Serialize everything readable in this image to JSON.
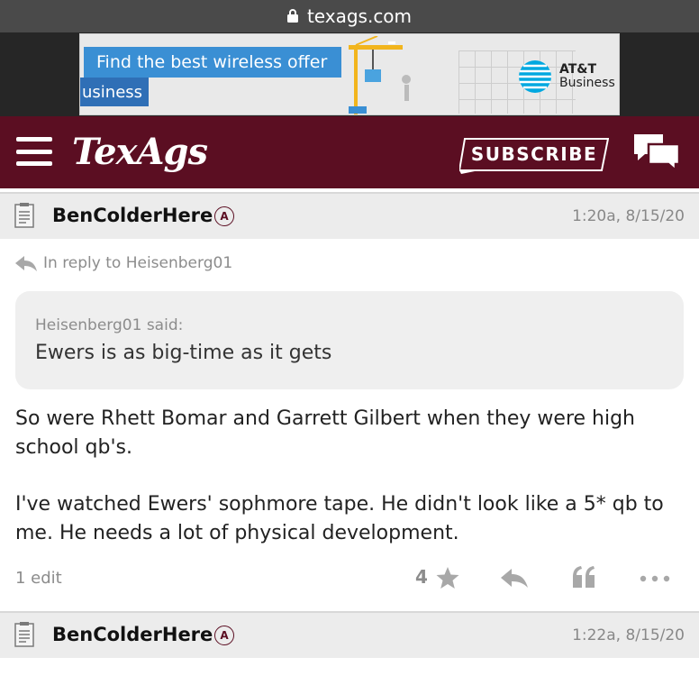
{
  "browser": {
    "url": "texags.com",
    "lock_icon": "lock-icon"
  },
  "ad": {
    "offer_text": "Find the best wireless offer",
    "business_text": "usiness",
    "brand_line1": "AT&T",
    "brand_line2": "Business",
    "brand_color": "#00a8e0"
  },
  "site": {
    "logo": "TexAgs",
    "subscribe_label": "SUBSCRIBE",
    "menu_icon": "hamburger-menu-icon",
    "chat_icon": "chat-bubbles-icon",
    "header_color": "#5b0e22"
  },
  "posts": [
    {
      "author": "BenColderHere",
      "badge": "A",
      "time": "1:20a, 8/15/20",
      "reply_to": "In reply to Heisenberg01",
      "quote_author": "Heisenberg01 said:",
      "quote_text": "Ewers is as big-time as it gets",
      "body": [
        "So were Rhett Bomar and Garrett Gilbert when they were high school qb's.",
        "I've watched Ewers' sophmore tape. He didn't look like a 5* qb to me. He needs a lot of physical development."
      ],
      "edits": "1 edit",
      "stars": "4"
    },
    {
      "author": "BenColderHere",
      "badge": "A",
      "time": "1:22a, 8/15/20"
    }
  ]
}
